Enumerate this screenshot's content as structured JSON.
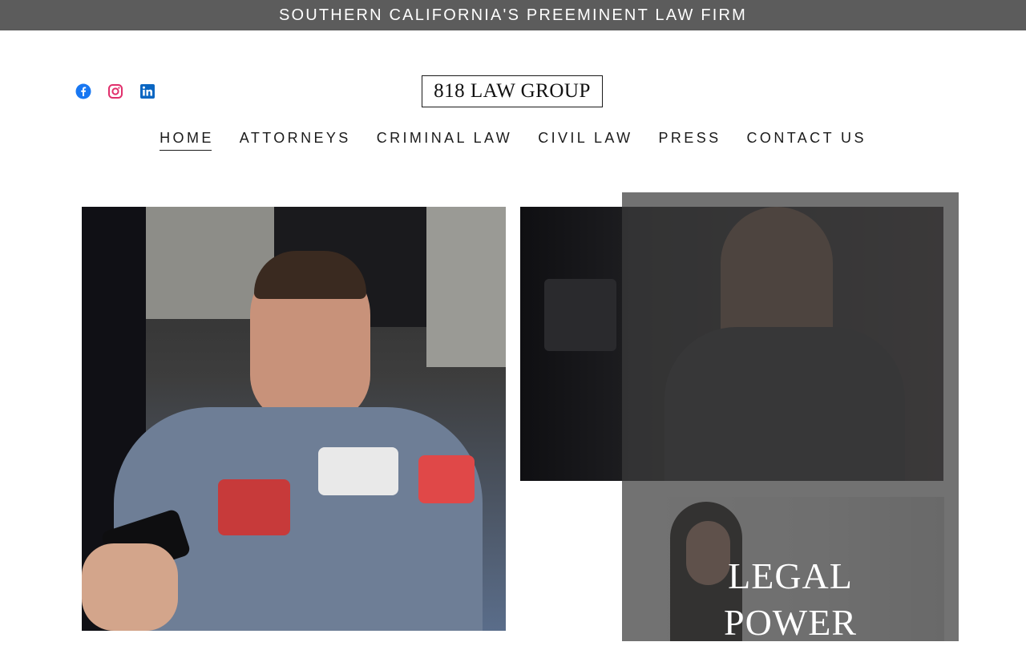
{
  "banner": {
    "text": "SOUTHERN CALIFORNIA'S PREEMINENT LAW FIRM"
  },
  "social": [
    {
      "name": "facebook-icon",
      "color": "#1877f2"
    },
    {
      "name": "instagram-icon",
      "color": "#e1306c"
    },
    {
      "name": "linkedin-icon",
      "color": "#0a66c2"
    }
  ],
  "logo": {
    "text": "818 LAW GROUP"
  },
  "nav": {
    "items": [
      {
        "label": "HOME",
        "active": true
      },
      {
        "label": "ATTORNEYS",
        "active": false
      },
      {
        "label": "CRIMINAL LAW",
        "active": false
      },
      {
        "label": "CIVIL LAW",
        "active": false
      },
      {
        "label": "PRESS",
        "active": false
      },
      {
        "label": "CONTACT US",
        "active": false
      }
    ]
  },
  "hero": {
    "title_line1": "LEGAL",
    "title_line2": "POWER"
  },
  "colors": {
    "banner_bg": "#5c5c5c",
    "overlay": "#3c3c3c"
  }
}
